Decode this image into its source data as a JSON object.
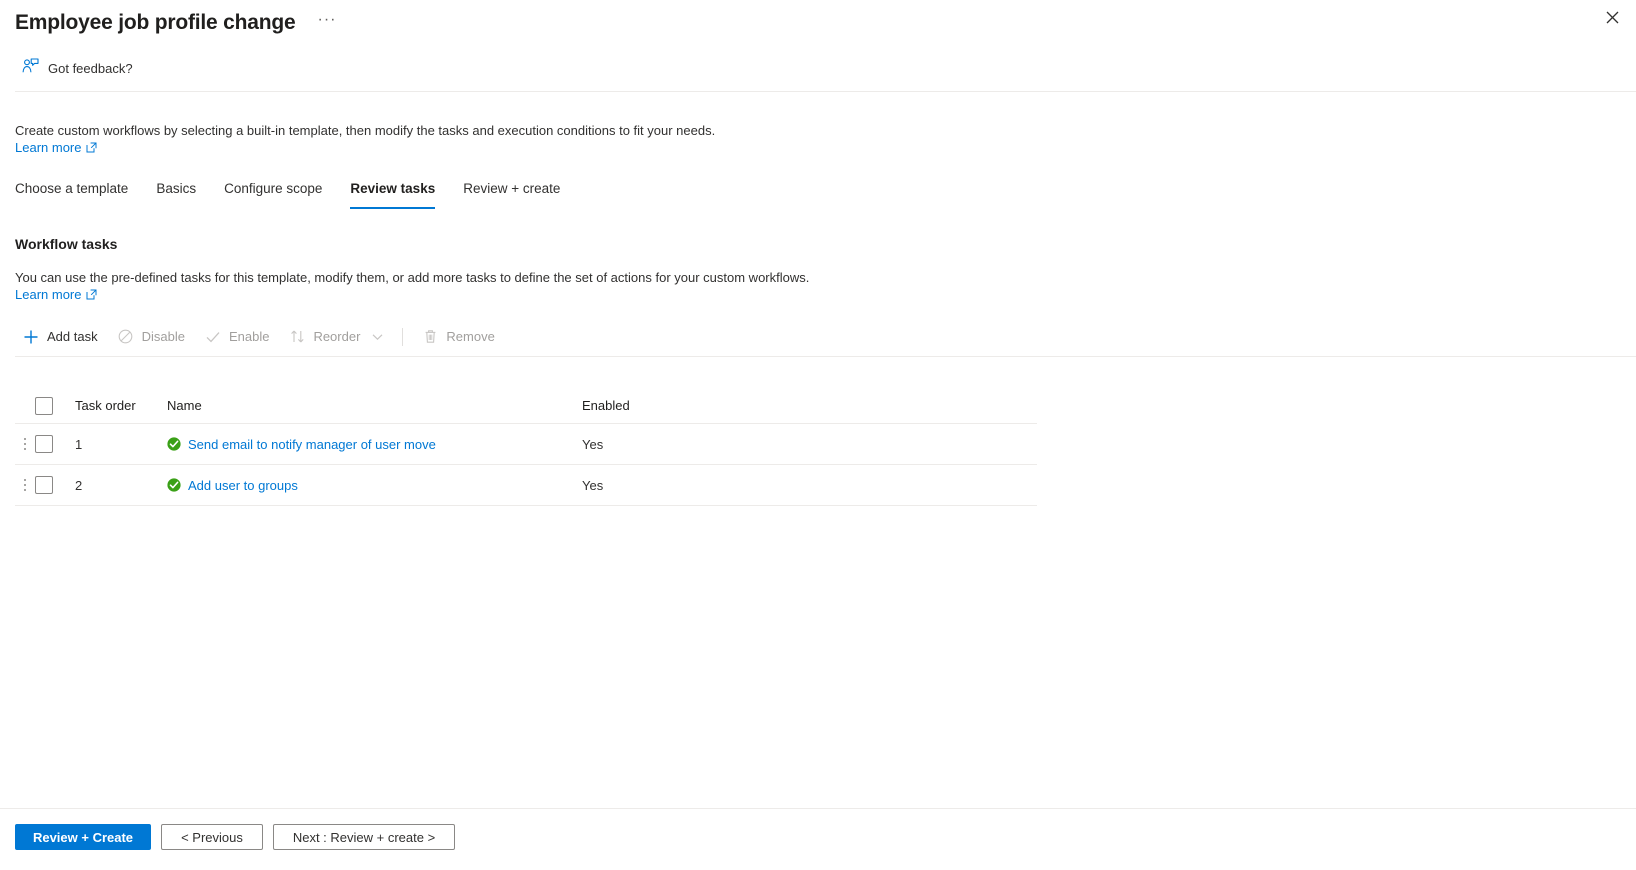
{
  "blade": {
    "title": "Employee job profile change",
    "more_label": "···",
    "close_label": "✕"
  },
  "feedback": {
    "label": "Got feedback?",
    "icon": "feedback-person-icon"
  },
  "intro": {
    "description": "Create custom workflows by selecting a built-in template, then modify the tasks and execution conditions to fit your needs.",
    "learn_more": "Learn more",
    "external_icon": "external-link-icon"
  },
  "tabs": [
    {
      "label": "Choose a template",
      "active": false
    },
    {
      "label": "Basics",
      "active": false
    },
    {
      "label": "Configure scope",
      "active": false
    },
    {
      "label": "Review tasks",
      "active": true
    },
    {
      "label": "Review + create",
      "active": false
    }
  ],
  "section": {
    "title": "Workflow tasks",
    "description": "You can use the pre-defined tasks for this template, modify them, or add more tasks to define the set of actions for your custom workflows.",
    "learn_more": "Learn more"
  },
  "toolbar": {
    "add_task": {
      "label": "Add task",
      "icon": "plus-icon",
      "enabled": true
    },
    "disable": {
      "label": "Disable",
      "icon": "block-icon",
      "enabled": false
    },
    "enable": {
      "label": "Enable",
      "icon": "checkmark-icon",
      "enabled": false
    },
    "reorder": {
      "label": "Reorder",
      "icon": "sort-updown-icon",
      "chevron": "chevron-down-icon",
      "enabled": false
    },
    "remove": {
      "label": "Remove",
      "icon": "trash-icon",
      "enabled": false
    }
  },
  "table": {
    "columns": [
      "Task order",
      "Name",
      "Enabled"
    ],
    "select_all_checked": false,
    "rows": [
      {
        "order": "1",
        "name": "Send email to notify manager of user move",
        "enabled": "Yes",
        "status_icon": "green-check-circle-icon",
        "checked": false
      },
      {
        "order": "2",
        "name": "Add user to groups",
        "enabled": "Yes",
        "status_icon": "green-check-circle-icon",
        "checked": false
      }
    ]
  },
  "footer": {
    "primary": "Review + Create",
    "previous": "< Previous",
    "next": "Next : Review + create >"
  },
  "colors": {
    "accent": "#0078d4",
    "success": "#3aa017",
    "text": "#323130",
    "disabled": "#a19f9d",
    "border": "#edebe9"
  }
}
